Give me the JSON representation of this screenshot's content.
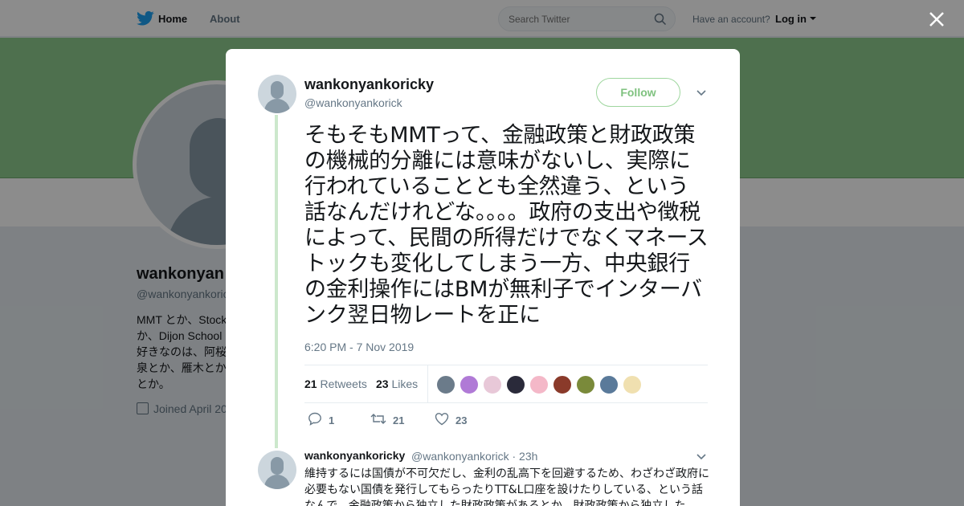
{
  "nav": {
    "home": "Home",
    "about": "About"
  },
  "search": {
    "placeholder": "Search Twitter"
  },
  "account": {
    "prompt": "Have an account?",
    "login": "Log in"
  },
  "profile": {
    "name": "wankonyan",
    "handle": "@wankonyankoric",
    "bio": "MMT とか、Stock か、Dijon School 好きなのは、阿桜 泉とか、雁木とか とか。",
    "joined": "Joined April 20"
  },
  "tweet": {
    "name": "wankonyankoricky",
    "handle": "@wankonyankorick",
    "follow_label": "Follow",
    "text": "そもそもMMTって、金融政策と財政政策の機械的分離には意味がないし、実際に行われていることとも全然違う、という話なんだけれどな。。。。政府の支出や徴税によって、民間の所得だけでなくマネーストックも変化してしまう一方、中央銀行の金利操作にはBMが無利子でインターバンク翌日物レートを正に",
    "time": "6:20 PM - 7 Nov 2019",
    "retweets_count": "21",
    "retweets_label": "Retweets",
    "likes_count": "23",
    "likes_label": "Likes",
    "reply_count": "1",
    "retweet_action_count": "21",
    "like_action_count": "23",
    "liker_colors": [
      "#6b7b8a",
      "#b07ad6",
      "#e8c8d8",
      "#2a2a3a",
      "#f4b8c8",
      "#8a3a2a",
      "#7a8a3a",
      "#5a7a9a",
      "#f0e0b0"
    ]
  },
  "reply": {
    "name": "wankonyankoricky",
    "meta": "@wankonyankorick · 23h",
    "text": "維持するには国債が不可欠だし、金利の乱高下を回避するため、わざわざ政府に必要もない国債を発行してもらったりTT&L口座を設けたりしている、という話なんで、金融政策から独立した財政政策があるとか、財政政策から独立した"
  },
  "colors": {
    "banner": "#8fcc8f",
    "accent": "#7fc27f",
    "thread": "#cce8cc"
  }
}
